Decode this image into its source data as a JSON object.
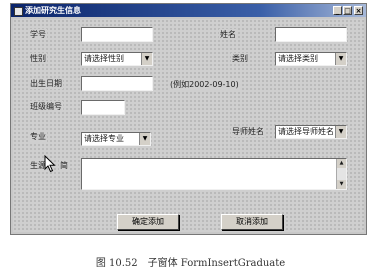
{
  "window": {
    "title": "添加研究生信息",
    "controls": {
      "minimize": "_",
      "maximize": "□",
      "close": "×"
    }
  },
  "form": {
    "student_id": {
      "label": "学号",
      "value": ""
    },
    "name": {
      "label": "姓名",
      "value": ""
    },
    "gender": {
      "label": "性别",
      "value": "请选择性别"
    },
    "category": {
      "label": "类别",
      "value": "请选择类别"
    },
    "birth_date": {
      "label": "出生日期",
      "value": "",
      "hint": "(例如2002-09-10)"
    },
    "class_id": {
      "label": "班级编号",
      "value": ""
    },
    "major": {
      "label": "专业",
      "value": "请选择专业"
    },
    "advisor": {
      "label": "导师姓名",
      "value": "请选择导师姓名"
    },
    "resume": {
      "label": "生源",
      "label2": "简",
      "value": ""
    }
  },
  "buttons": {
    "confirm": "确定添加",
    "cancel": "取消添加"
  },
  "caption": "图 10.52　子窗体 FormInsertGraduate"
}
